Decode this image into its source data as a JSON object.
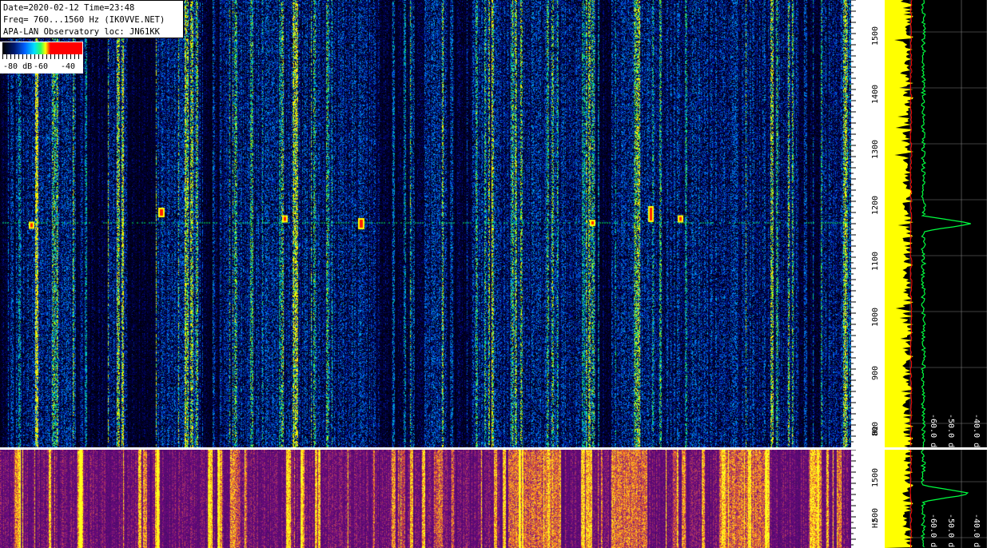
{
  "header": {
    "line1": "Date=2020-02-12 Time=23:48",
    "line2": "Freq= 760...1560 Hz (IK0VVE.NET)",
    "line3": "APA-LAN Observatory loc: JN61KK"
  },
  "colorbar": {
    "label_left": "-80 dB",
    "label_mid": "-60",
    "label_right": "-40"
  },
  "freq_axis_top": {
    "unit": "Hz",
    "ticks": [
      "1500",
      "1400",
      "1300",
      "1200",
      "1100",
      "1000",
      "900",
      "800"
    ]
  },
  "freq_axis_bottom": {
    "unit": "Hz",
    "ticks": [
      "1500",
      "500"
    ]
  },
  "spectrum_top": {
    "db_labels": [
      "-60.0 dB",
      "-50.0 dB",
      "-40.0 dB"
    ]
  },
  "spectrum_bottom": {
    "db_labels": [
      "-60.0 dB",
      "-50.0 dB",
      "-40.0 dB"
    ]
  },
  "colors": {
    "trace_yellow": "#ffff00",
    "trace_green": "#00ff40",
    "trace_red": "#ff0000",
    "grid": "#808080"
  }
}
